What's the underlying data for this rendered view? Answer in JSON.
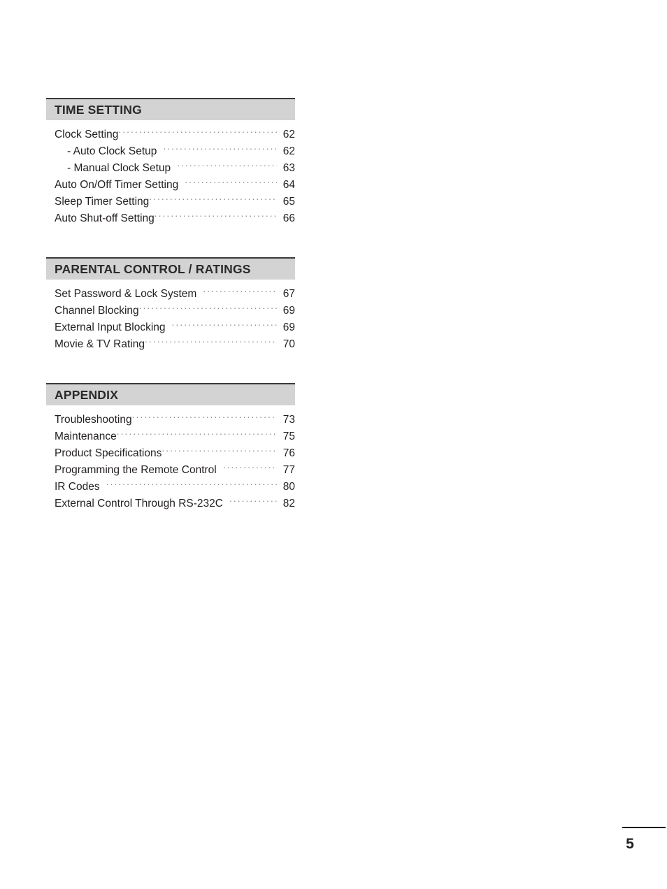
{
  "document": {
    "page_number": "5"
  },
  "toc": {
    "sections": [
      {
        "title": "TIME SETTING",
        "entries": [
          {
            "label": "Clock Setting",
            "page": "62",
            "sub": false,
            "gap": false
          },
          {
            "label": "- Auto Clock Setup",
            "page": "62",
            "sub": true,
            "gap": true
          },
          {
            "label": "- Manual Clock Setup",
            "page": "63",
            "sub": true,
            "gap": true
          },
          {
            "label": "Auto On/Off Timer Setting",
            "page": "64",
            "sub": false,
            "gap": true
          },
          {
            "label": "Sleep Timer Setting",
            "page": "65",
            "sub": false,
            "gap": false
          },
          {
            "label": "Auto Shut-off Setting",
            "page": "66",
            "sub": false,
            "gap": false
          }
        ]
      },
      {
        "title": "PARENTAL CONTROL / RATINGS",
        "entries": [
          {
            "label": "Set Password & Lock System",
            "page": "67",
            "sub": false,
            "gap": true
          },
          {
            "label": "Channel Blocking",
            "page": "69",
            "sub": false,
            "gap": false
          },
          {
            "label": "External Input Blocking",
            "page": "69",
            "sub": false,
            "gap": true
          },
          {
            "label": "Movie & TV Rating",
            "page": "70",
            "sub": false,
            "gap": false
          }
        ]
      },
      {
        "title": "APPENDIX",
        "entries": [
          {
            "label": "Troubleshooting",
            "page": "73",
            "sub": false,
            "gap": false
          },
          {
            "label": "Maintenance",
            "page": "75",
            "sub": false,
            "gap": false
          },
          {
            "label": "Product Specifications",
            "page": "76",
            "sub": false,
            "gap": false
          },
          {
            "label": "Programming the Remote Control",
            "page": "77",
            "sub": false,
            "gap": true
          },
          {
            "label": "IR Codes",
            "page": "80",
            "sub": false,
            "gap": true
          },
          {
            "label": "External Control Through RS-232C",
            "page": "82",
            "sub": false,
            "gap": true
          }
        ]
      }
    ]
  },
  "colors": {
    "section_band": "#d3d3d3",
    "band_top_rule": "#3b3b3b",
    "text": "#231f20",
    "leader_dots": "#8e8e8e"
  }
}
